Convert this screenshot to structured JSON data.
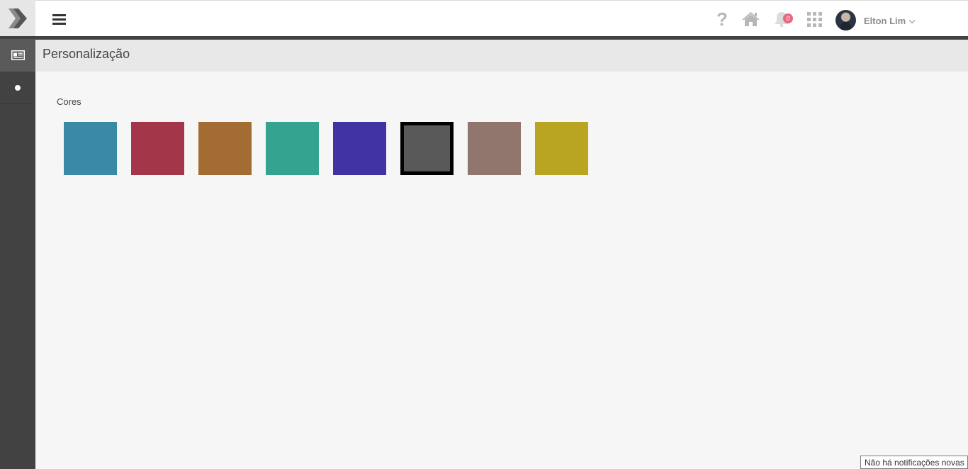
{
  "app": {
    "logo_icon": "brand-chevron-logo-icon"
  },
  "header": {
    "menu_icon": "hamburger-menu-icon",
    "help_glyph": "?",
    "notification_count": "0",
    "user_name": "Elton Lim",
    "icons": [
      "help-icon",
      "home-icon",
      "bell-icon",
      "apps-grid-icon",
      "avatar",
      "chevron-down-icon"
    ]
  },
  "sidebar": {
    "items": [
      {
        "icon": "newspaper-icon",
        "active": true
      },
      {
        "icon": "dot-icon",
        "active": false
      }
    ]
  },
  "page": {
    "title": "Personalização"
  },
  "colors_section": {
    "label": "Cores",
    "swatches": [
      {
        "color": "#3a8aa5",
        "selected": false
      },
      {
        "color": "#a43649",
        "selected": false
      },
      {
        "color": "#a36c33",
        "selected": false
      },
      {
        "color": "#34a38f",
        "selected": false
      },
      {
        "color": "#4233a4",
        "selected": false
      },
      {
        "color": "#595959",
        "selected": true
      },
      {
        "color": "#90766c",
        "selected": false
      },
      {
        "color": "#b9a521",
        "selected": false
      }
    ]
  },
  "tooltip": {
    "text": "Não há notificações novas"
  }
}
